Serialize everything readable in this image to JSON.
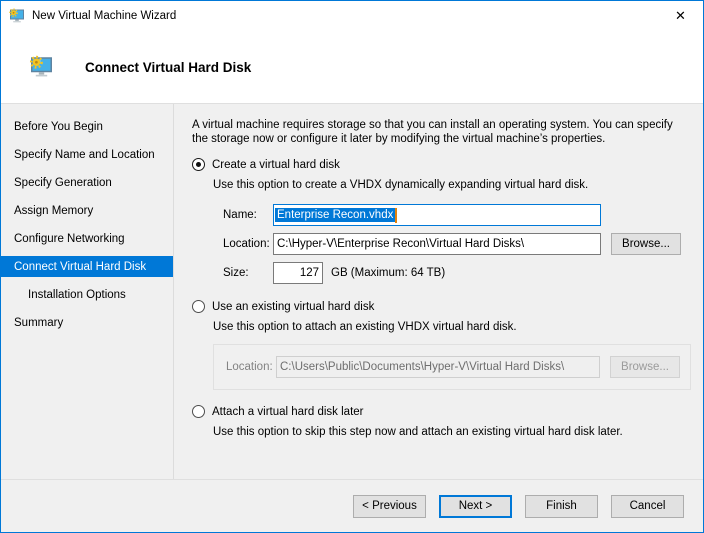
{
  "window": {
    "title": "New Virtual Machine Wizard",
    "close_glyph": "✕"
  },
  "header": {
    "title": "Connect Virtual Hard Disk"
  },
  "accent_color": "#0078d7",
  "sidebar": {
    "items": [
      {
        "label": "Before You Begin"
      },
      {
        "label": "Specify Name and Location"
      },
      {
        "label": "Specify Generation"
      },
      {
        "label": "Assign Memory"
      },
      {
        "label": "Configure Networking"
      },
      {
        "label": "Connect Virtual Hard Disk"
      },
      {
        "label": "Installation Options"
      },
      {
        "label": "Summary"
      }
    ]
  },
  "content": {
    "intro": "A virtual machine requires storage so that you can install an operating system. You can specify the storage now or configure it later by modifying the virtual machine’s properties.",
    "create": {
      "label": "Create a virtual hard disk",
      "description": "Use this option to create a VHDX dynamically expanding virtual hard disk.",
      "name_label": "Name:",
      "name_value": "Enterprise Recon.vhdx",
      "location_label": "Location:",
      "location_value": "C:\\Hyper-V\\Enterprise Recon\\Virtual Hard Disks\\",
      "browse_label": "Browse...",
      "size_label": "Size:",
      "size_value": "127",
      "size_suffix": "GB (Maximum: 64 TB)"
    },
    "existing": {
      "label": "Use an existing virtual hard disk",
      "description": "Use this option to attach an existing VHDX virtual hard disk.",
      "location_label": "Location:",
      "location_value": "C:\\Users\\Public\\Documents\\Hyper-V\\Virtual Hard Disks\\",
      "browse_label": "Browse..."
    },
    "later": {
      "label": "Attach a virtual hard disk later",
      "description": "Use this option to skip this step now and attach an existing virtual hard disk later."
    }
  },
  "footer": {
    "previous_label": "< Previous",
    "next_label": "Next >",
    "finish_label": "Finish",
    "cancel_label": "Cancel"
  }
}
